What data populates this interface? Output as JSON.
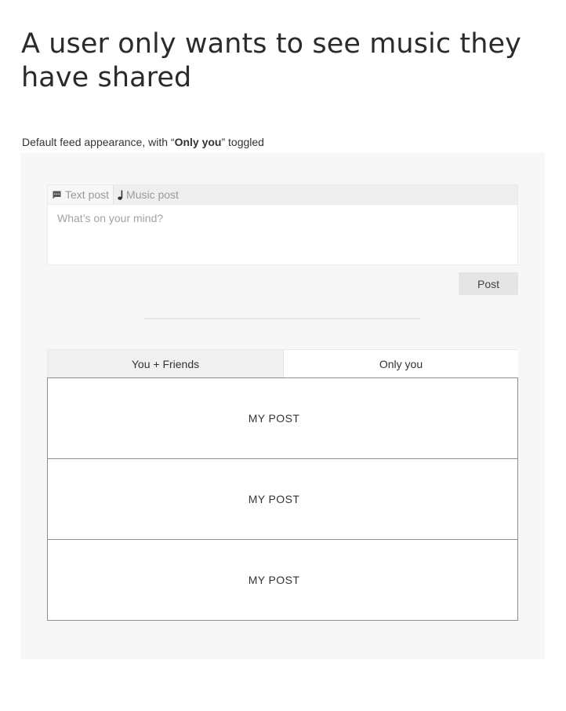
{
  "page": {
    "title": "A user only wants to see music they have shared",
    "caption_prefix": "Default feed appearance, with “",
    "caption_bold": "Only you",
    "caption_suffix": "” toggled"
  },
  "composer": {
    "tabs": [
      {
        "label": "Text post",
        "icon": "chat-bubble-icon",
        "active": true
      },
      {
        "label": "Music post",
        "icon": "music-note-icon",
        "active": false
      }
    ],
    "placeholder": "What’s on your mind?",
    "post_label": "Post"
  },
  "feed_toggle": {
    "tabs": [
      {
        "label": "You + Friends",
        "selected": false
      },
      {
        "label": "Only you",
        "selected": true
      }
    ]
  },
  "feed": {
    "items": [
      {
        "label": "MY POST"
      },
      {
        "label": "MY POST"
      },
      {
        "label": "MY POST"
      }
    ]
  }
}
